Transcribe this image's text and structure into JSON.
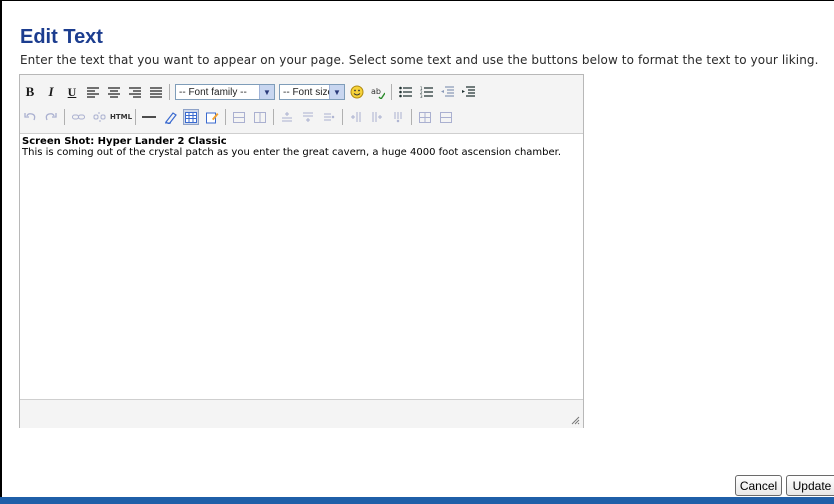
{
  "dialog": {
    "title": "Edit Text",
    "instructions": "Enter the text that you want to appear on your page. Select some text and use the buttons below to format the text to your liking."
  },
  "toolbar": {
    "bold_label": "B",
    "italic_label": "I",
    "underline_label": "U",
    "font_family_placeholder": "-- Font family --",
    "font_size_placeholder": "-- Font size --",
    "html_label": "HTML"
  },
  "content": {
    "title": "Screen Shot: Hyper Lander 2 Classic",
    "body": "This is coming out of the crystal patch as you enter the great cavern, a huge 4000 foot ascension chamber."
  },
  "buttons": {
    "cancel_label": "Cancel",
    "update_label": "Update"
  },
  "colors": {
    "title": "#1c3d8f",
    "accent_bar": "#1f5fa8"
  }
}
